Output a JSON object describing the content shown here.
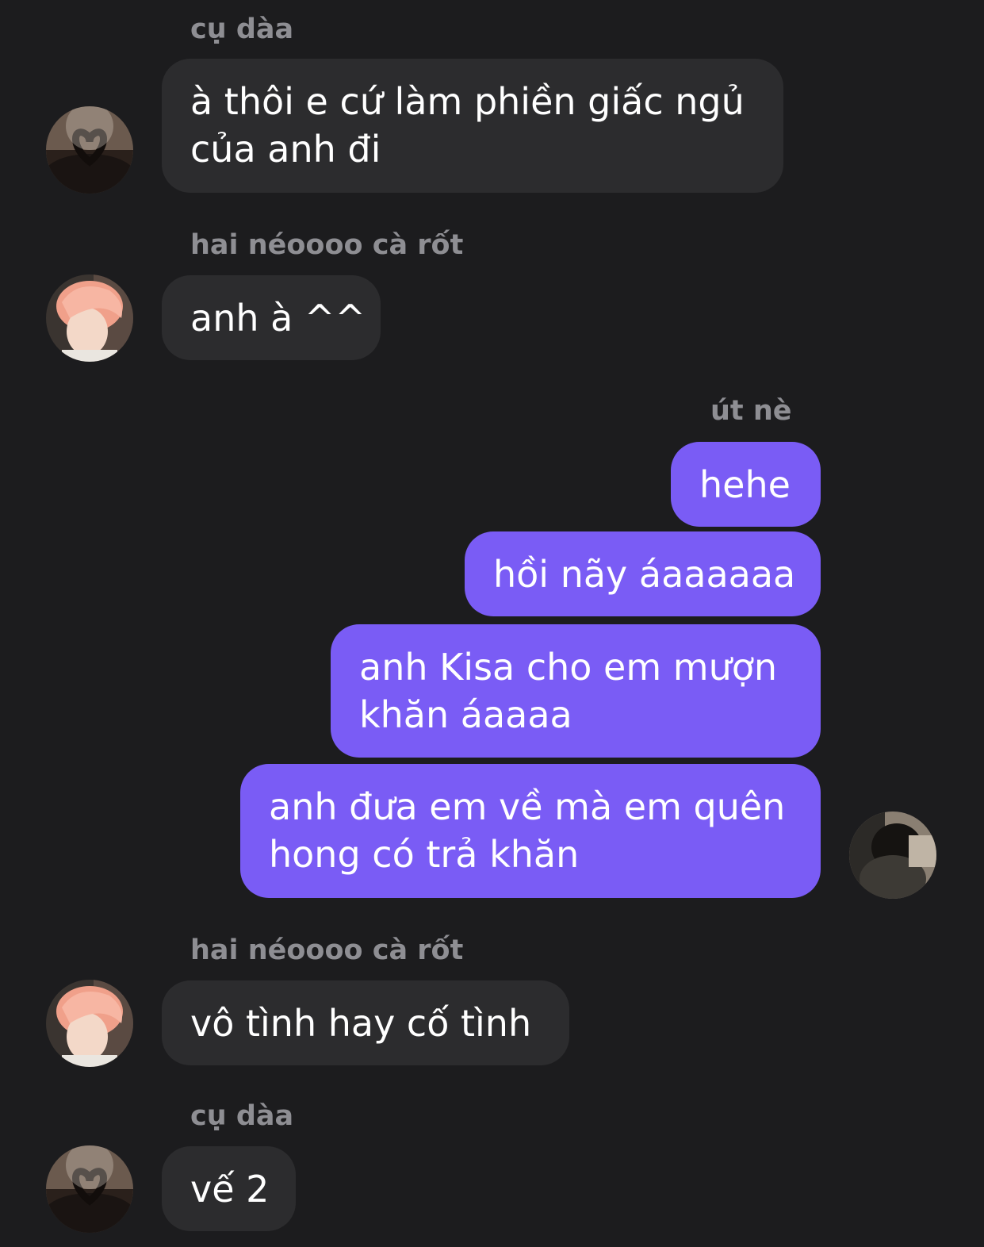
{
  "accent_color": "#7a5cf5",
  "incoming_bubble_color": "#2c2c2e",
  "background_color": "#1c1c1e",
  "messages": [
    {
      "sender": "cụ dàa",
      "direction": "incoming",
      "avatar": "heart-hair-avatar",
      "lines": [
        "à thôi e cứ làm phiền giấc ngủ",
        "của anh đi"
      ]
    },
    {
      "sender": "hai néoooo cà rốt",
      "direction": "incoming",
      "avatar": "pink-hair-avatar",
      "lines": [
        "anh à ^^"
      ]
    },
    {
      "sender": "út nè",
      "direction": "outgoing",
      "avatar": "dark-photo-avatar",
      "lines": [
        "hehe"
      ]
    },
    {
      "sender": "",
      "direction": "outgoing",
      "lines": [
        "hồi nãy áaaaaaa"
      ]
    },
    {
      "sender": "",
      "direction": "outgoing",
      "lines": [
        "anh Kisa cho em mượn",
        "khăn áaaaa"
      ]
    },
    {
      "sender": "",
      "direction": "outgoing",
      "lines": [
        "anh đưa em về mà em quên",
        "hong có trả khăn"
      ]
    },
    {
      "sender": "hai néoooo cà rốt",
      "direction": "incoming",
      "avatar": "pink-hair-avatar",
      "lines": [
        "vô tình hay cố tình"
      ]
    },
    {
      "sender": "cụ dàa",
      "direction": "incoming",
      "avatar": "heart-hair-avatar",
      "lines": [
        "vế 2"
      ]
    }
  ]
}
